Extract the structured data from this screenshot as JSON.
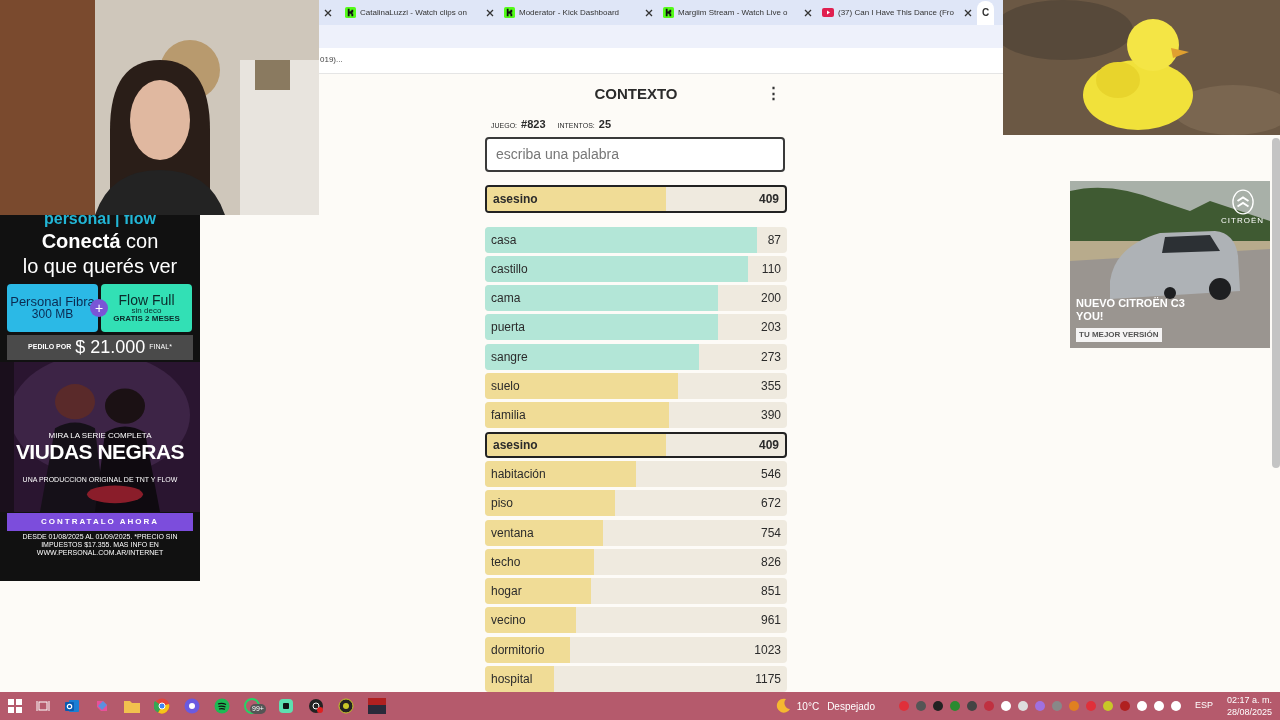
{
  "browser": {
    "tabs": [
      {
        "kind": "stub",
        "selected": false
      },
      {
        "title": "CatalinaLuzzi - Watch clips on",
        "kind": "kick",
        "selected": false
      },
      {
        "title": "Moderator - Kick Dashboard",
        "kind": "kick",
        "selected": false
      },
      {
        "title": "Margiim Stream - Watch Live o",
        "kind": "kick",
        "selected": false
      },
      {
        "title": "(37) Can I Have This Dance (Fro",
        "kind": "youtube",
        "selected": false
      },
      {
        "title": "C",
        "kind": "letter",
        "selected": true
      }
    ],
    "bookmark_text": "019)..."
  },
  "game": {
    "title": "CONTEXTO",
    "menu_icon": "⋮",
    "game_label": "JUEGO:",
    "game_number": "#823",
    "attempts_label": "INTENTOS:",
    "attempts": "25",
    "input": {
      "placeholder": "escriba una palabra"
    },
    "last_guess": {
      "word": "asesino",
      "rank": "409",
      "level": 0.6,
      "color": "#f0dc96"
    },
    "guesses": [
      {
        "word": "casa",
        "rank": "87",
        "level": 0.9,
        "color": "#b3e6d7",
        "selected": false
      },
      {
        "word": "castillo",
        "rank": "110",
        "level": 0.87,
        "color": "#b3e6d7",
        "selected": false
      },
      {
        "word": "cama",
        "rank": "200",
        "level": 0.77,
        "color": "#b3e6d7",
        "selected": false
      },
      {
        "word": "puerta",
        "rank": "203",
        "level": 0.77,
        "color": "#b3e6d7",
        "selected": false
      },
      {
        "word": "sangre",
        "rank": "273",
        "level": 0.71,
        "color": "#b3e6d7",
        "selected": false
      },
      {
        "word": "suelo",
        "rank": "355",
        "level": 0.64,
        "color": "#f0dc96",
        "selected": false
      },
      {
        "word": "familia",
        "rank": "390",
        "level": 0.61,
        "color": "#f0dc96",
        "selected": false
      },
      {
        "word": "asesino",
        "rank": "409",
        "level": 0.6,
        "color": "#f0dc96",
        "selected": true
      },
      {
        "word": "habitación",
        "rank": "546",
        "level": 0.5,
        "color": "#f0dc96",
        "selected": false
      },
      {
        "word": "piso",
        "rank": "672",
        "level": 0.43,
        "color": "#f0dc96",
        "selected": false
      },
      {
        "word": "ventana",
        "rank": "754",
        "level": 0.39,
        "color": "#f0dc96",
        "selected": false
      },
      {
        "word": "techo",
        "rank": "826",
        "level": 0.36,
        "color": "#f0dc96",
        "selected": false
      },
      {
        "word": "hogar",
        "rank": "851",
        "level": 0.35,
        "color": "#f0dc96",
        "selected": false
      },
      {
        "word": "vecino",
        "rank": "961",
        "level": 0.3,
        "color": "#f0dc96",
        "selected": false
      },
      {
        "word": "dormitorio",
        "rank": "1023",
        "level": 0.28,
        "color": "#f0dc96",
        "selected": false
      },
      {
        "word": "hospital",
        "rank": "1175",
        "level": 0.23,
        "color": "#f0dc96",
        "selected": false
      }
    ]
  },
  "left_ad": {
    "brand": "personal | flow",
    "headline_bold": "Conectá",
    "headline_rest": "con",
    "headline_line2": "lo que querés ver",
    "plan1": "Personal Fibra",
    "plan1_detail": "300 MB",
    "plus": "+",
    "plan2": "Flow Full",
    "plan2_note": "sin deco",
    "plan2_detail": "GRATIS 2 MESES",
    "price_label": "PEDILO POR",
    "price": "$ 21.000",
    "price_suffix": "FINAL*",
    "series_intro": "MIRA LA SERIE COMPLETA",
    "series_title": "VIUDAS NEGRAS",
    "series_credit": "UNA PRODUCCION ORIGINAL DE TNT Y FLOW",
    "cta": "CONTRATALO AHORA",
    "legal": "DESDE 01/08/2025 AL 01/09/2025. *PRECIO SIN IMPUESTOS $17.355. MAS INFO EN WWW.PERSONAL.COM.AR/INTERNET"
  },
  "right_ad": {
    "brand": "CITROËN",
    "headline": "NUEVO CITROËN C3 YOU!",
    "tagline": "TU MEJOR VERSIÓN"
  },
  "taskbar": {
    "badge": "99+",
    "weather_temp": "10°C",
    "weather_text": "Despejado",
    "language": "ESP",
    "time": "02:17 a. m.",
    "date": "28/08/2025"
  }
}
